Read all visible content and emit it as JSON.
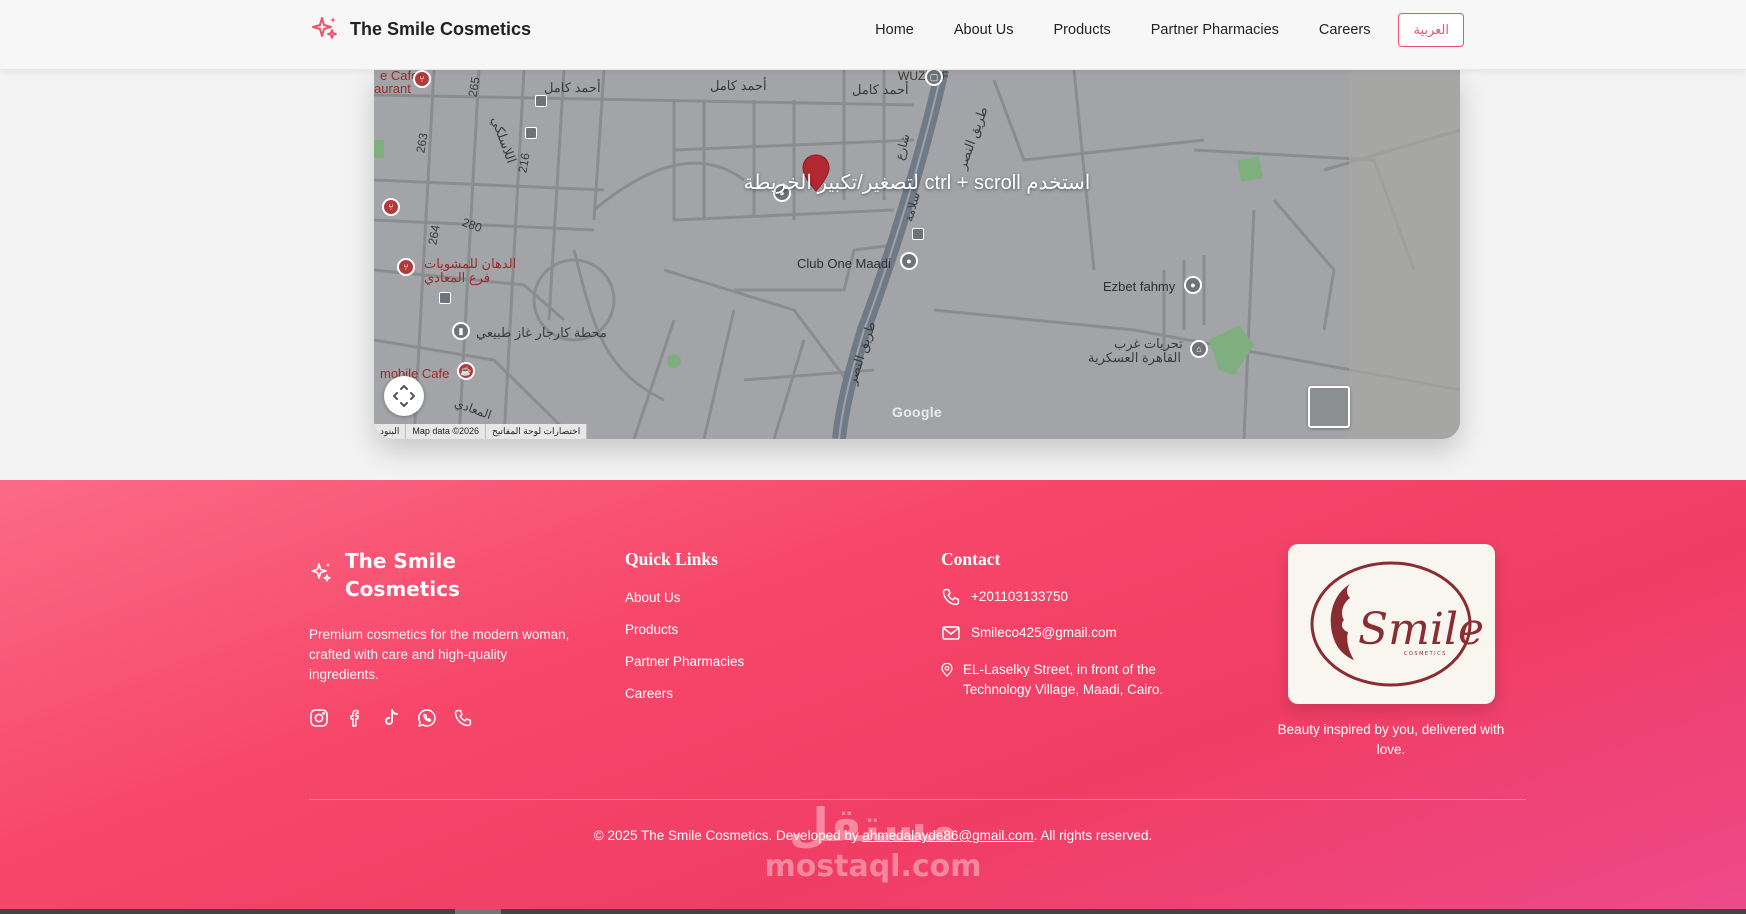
{
  "header": {
    "brand_name": "The Smile Cosmetics",
    "brand_icon": "sparkle-icon",
    "nav": [
      "Home",
      "About Us",
      "Products",
      "Partner Pharmacies",
      "Careers"
    ],
    "lang_button": "العربية"
  },
  "map": {
    "overlay_hint": "استخدم ctrl + scroll لتصغير/تكبير الخريطة",
    "labels": {
      "cafe": "e Cafe",
      "restaurant": "aurant",
      "ahmed_kamel_1": "أحمد كامل",
      "ahmed_kamel_2": "أحمد كامل",
      "ahmed_kamel_3": "أحمد كامل",
      "wuzzuf": "WUZZUF",
      "n265": "265",
      "n263": "263",
      "n216": "216",
      "n280": "280",
      "n264": "264",
      "laslki": "اللاسلكي",
      "street_ar": "شارع",
      "salama": "سلامة",
      "nasr_road_1": "طريق النصر",
      "nasr_road_2": "طريق النصر",
      "club_one": "Club One Maadi",
      "ezbet": "Ezbet fahmy",
      "dahan_1": "الدهان للمشويات",
      "dahan_2": "فرع المعادي",
      "station": "محطة كارجار غاز طبيعي",
      "mobile_cafe": "mobile Cafe",
      "tahreer_1": "تحريات غرب",
      "tahreer_2": "القاهرة العسكرية",
      "maadi": "المعادي"
    },
    "google_logo": "Google",
    "attribution": {
      "terms": "البنود",
      "map_data": "Map data ©2026",
      "shortcuts": "اختصارات لوحة المفاتيح"
    }
  },
  "footer": {
    "brand_name": "The Smile Cosmetics",
    "description": "Premium cosmetics for the modern woman, crafted with care and high-quality ingredients.",
    "socials": [
      "instagram-icon",
      "facebook-icon",
      "tiktok-icon",
      "whatsapp-icon",
      "phone-icon"
    ],
    "quick_links_title": "Quick Links",
    "quick_links": [
      "About Us",
      "Products",
      "Partner Pharmacies",
      "Careers"
    ],
    "contact_title": "Contact",
    "phone": "+201103133750",
    "email": "Smileco425@gmail.com",
    "address": "EL-Laselky Street, in front of the Technology Village, Maadi, Cairo.",
    "logo_text": "Smile",
    "logo_subtext": "COSMETICS",
    "tagline": "Beauty inspired by you, delivered with love.",
    "copyright_before": "© 2025 The Smile Cosmetics. Developed by ",
    "copyright_email": "ahmedalayde86@gmail.com",
    "copyright_after": ". All rights reserved.",
    "watermark_ar": "مستقل",
    "watermark_en": "mostaql.com"
  },
  "colors": {
    "accent": "#f0506e",
    "footer_start": "#fb6b85",
    "footer_end": "#ee4a8a",
    "logo_brown": "#8a2d33"
  }
}
